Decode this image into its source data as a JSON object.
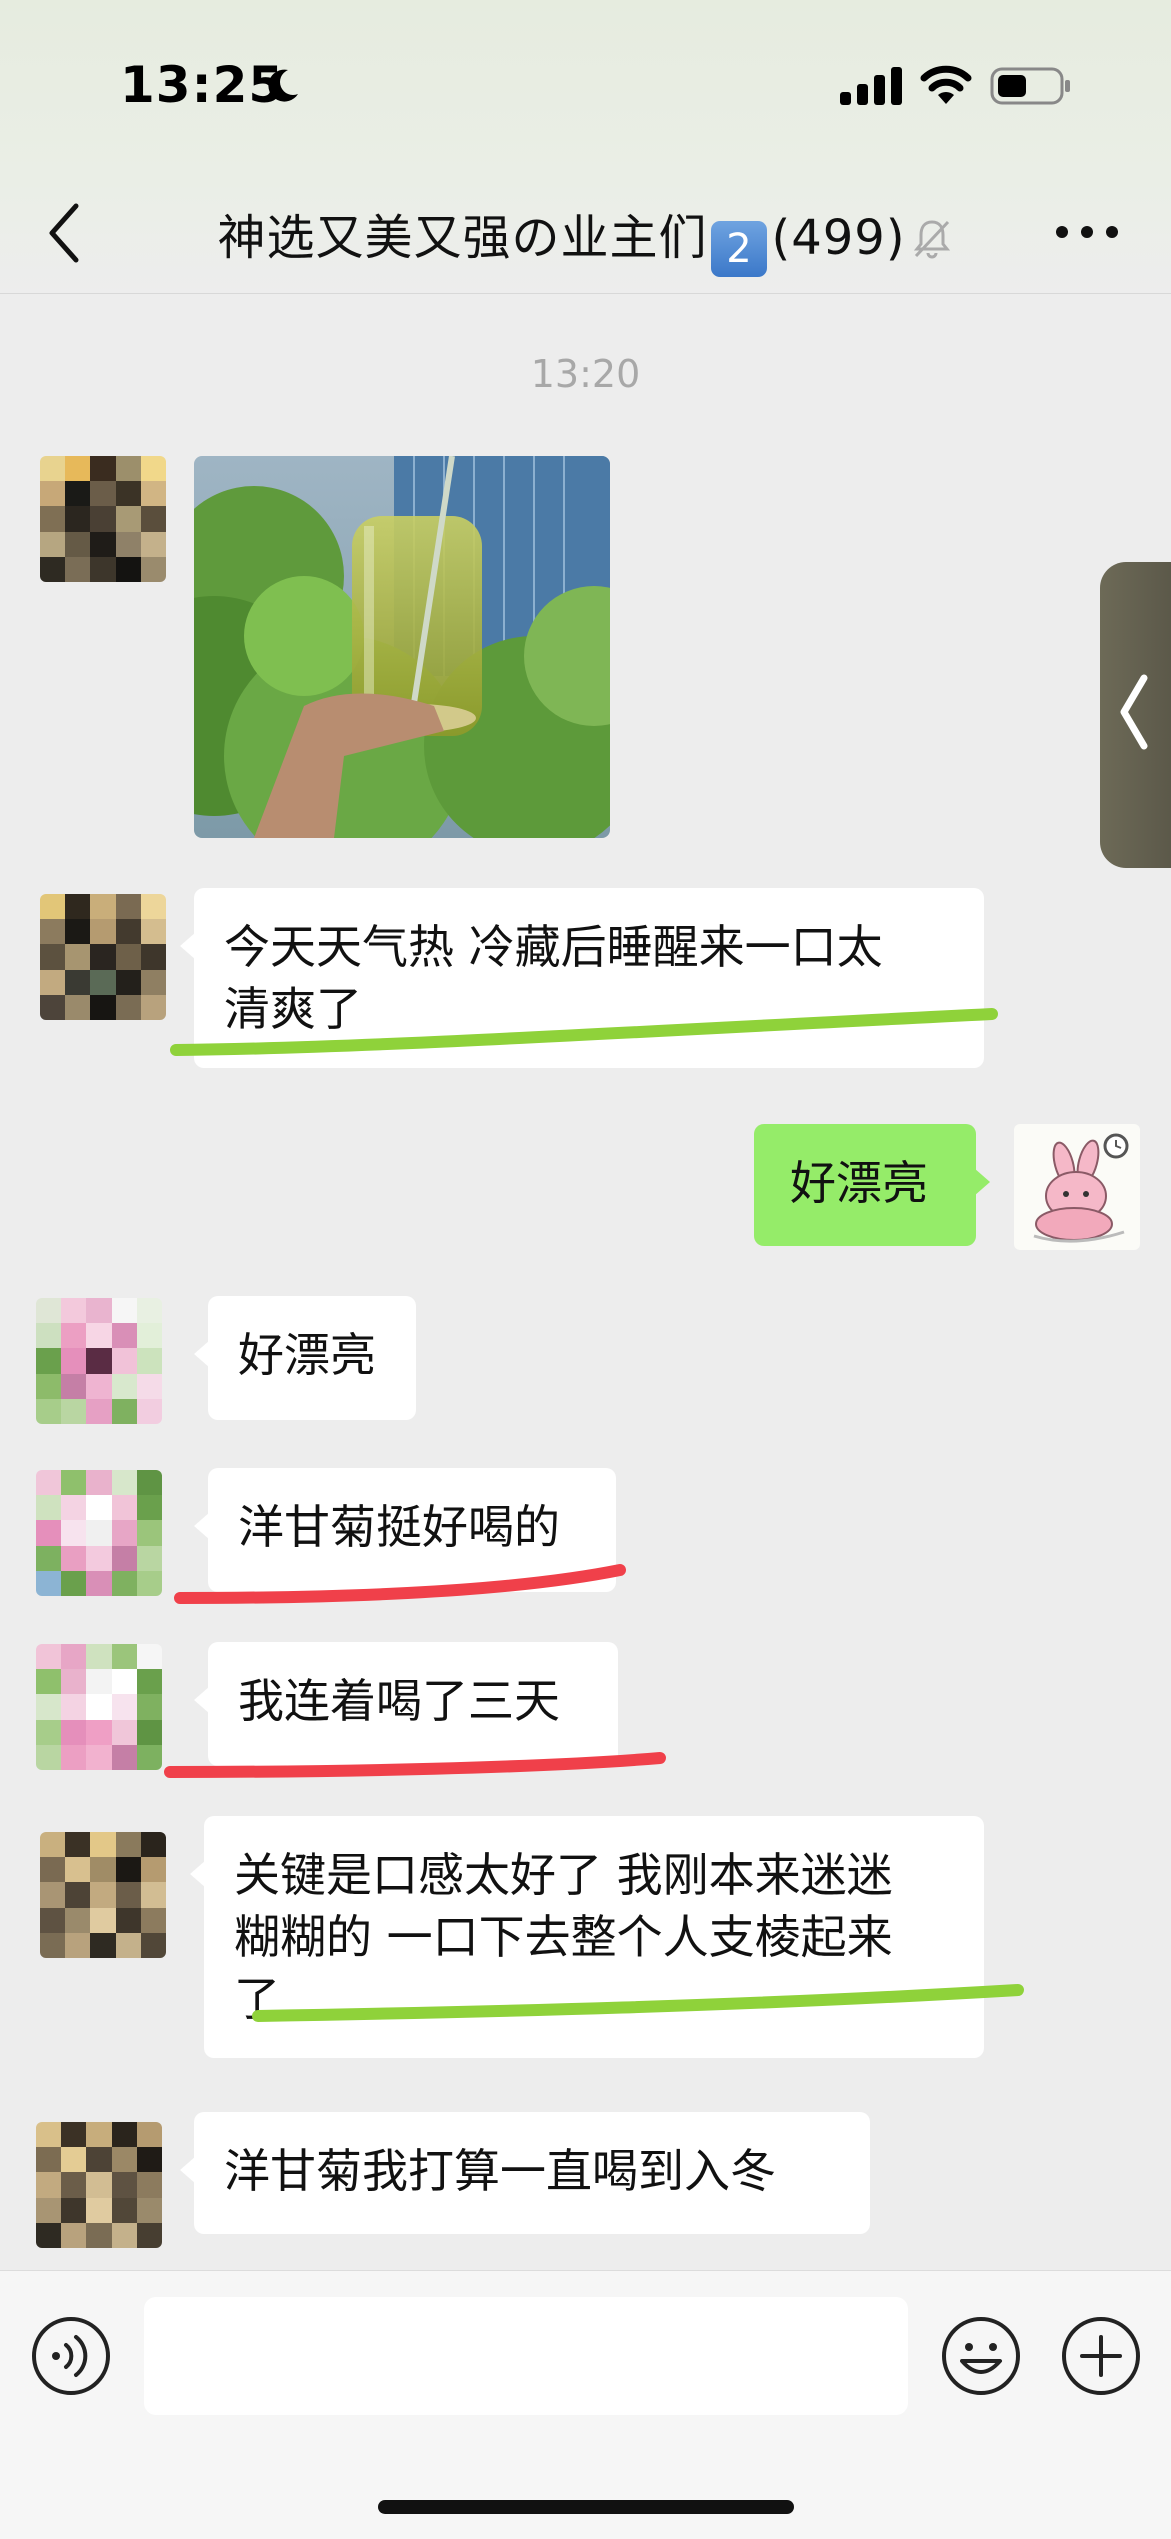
{
  "status_bar": {
    "time": "13:25",
    "icons": [
      "moon-icon",
      "signal-icon",
      "wifi-icon",
      "battery-icon"
    ]
  },
  "header": {
    "title": "神选又美又强の业主们",
    "badge": "2",
    "member_count": "(499)",
    "icons": [
      "back-icon",
      "mute-bell-icon",
      "more-icon"
    ]
  },
  "chat": {
    "timestamp": "13:20",
    "messages": [
      {
        "side": "left",
        "type": "image",
        "content": "photo of a glass jar of green chrysanthemum tea"
      },
      {
        "side": "left",
        "type": "text",
        "content": "今天天气热 冷藏后睡醒来一口太清爽了",
        "lines": [
          "今天天气热 冷藏后睡醒来一口太",
          "清爽了"
        ],
        "highlight": "#8fd23a"
      },
      {
        "side": "right",
        "type": "text",
        "content": "好漂亮"
      },
      {
        "side": "left",
        "type": "text",
        "content": "好漂亮"
      },
      {
        "side": "left",
        "type": "text",
        "content": "洋甘菊挺好喝的",
        "highlight": "#f0404a"
      },
      {
        "side": "left",
        "type": "text",
        "content": "我连着喝了三天",
        "highlight": "#f0404a"
      },
      {
        "side": "left",
        "type": "text",
        "content": "关键是口感太好了 我刚本来迷迷糊糊的 一口下去整个人支棱起来了",
        "lines": [
          "关键是口感太好了 我刚本来迷迷",
          "糊糊的 一口下去整个人支棱起来",
          "了"
        ],
        "highlight": "#8fd23a"
      },
      {
        "side": "left",
        "type": "text",
        "content": "洋甘菊我打算一直喝到入冬"
      }
    ]
  },
  "input_bar": {
    "icons": [
      "voice-icon",
      "emoji-icon",
      "plus-icon"
    ],
    "text": ""
  },
  "colors": {
    "background": "#ededed",
    "bubble_left": "#ffffff",
    "bubble_right": "#95ec69",
    "underline_green": "#8fd23a",
    "underline_red": "#f0404a"
  }
}
